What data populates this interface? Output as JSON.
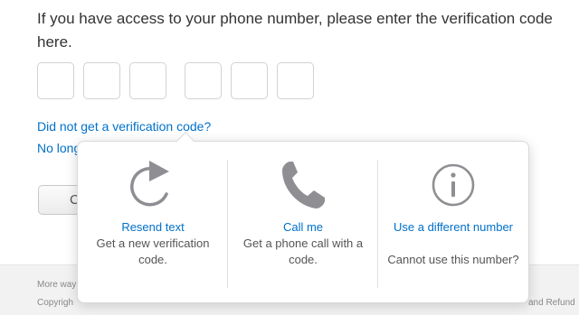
{
  "instruction": "If you have access to your phone number, please enter the verification code here.",
  "code_inputs": [
    "",
    "",
    "",
    "",
    "",
    ""
  ],
  "links": {
    "no_code": "Did not get a verification code?",
    "no_longer": "No long"
  },
  "continue_button_partial": "C",
  "footer": {
    "line1": "More way",
    "line2": "Copyrigh",
    "right": "and Refund"
  },
  "popover": {
    "options": [
      {
        "icon": "refresh-icon",
        "title": "Resend text",
        "description": "Get a new verification code."
      },
      {
        "icon": "phone-icon",
        "title": "Call me",
        "description": "Get a phone call with a code."
      },
      {
        "icon": "info-icon",
        "title": "Use a different number",
        "description": "Cannot use this number?"
      }
    ]
  },
  "colors": {
    "link": "#0070c9",
    "icon": "#8e8e93",
    "text": "#333333"
  }
}
